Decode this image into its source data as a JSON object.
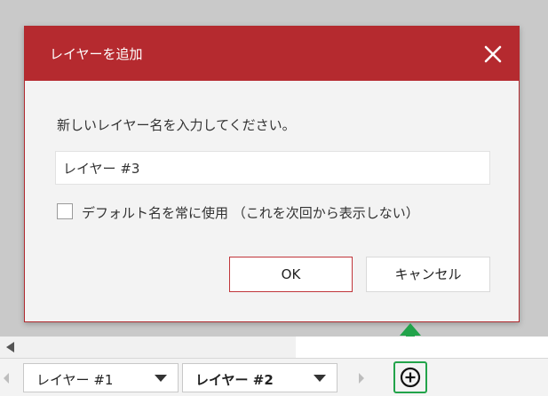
{
  "dialog": {
    "title": "レイヤーを追加",
    "prompt": "新しいレイヤー名を入力してください。",
    "name_value": "レイヤー #3",
    "checkbox_label": "デフォルト名を常に使用 （これを次回から表示しない）",
    "checkbox_checked": false,
    "ok_label": "OK",
    "cancel_label": "キャンセル"
  },
  "tabs": [
    {
      "label": "レイヤー #1",
      "active": false
    },
    {
      "label": "レイヤー #2",
      "active": true
    }
  ],
  "colors": {
    "titlebar": "#b52a2f",
    "highlight": "#22a34a"
  },
  "icons": {
    "close": "close-icon",
    "add_layer": "plus-circle-icon",
    "hint": "arrow-up-icon"
  }
}
